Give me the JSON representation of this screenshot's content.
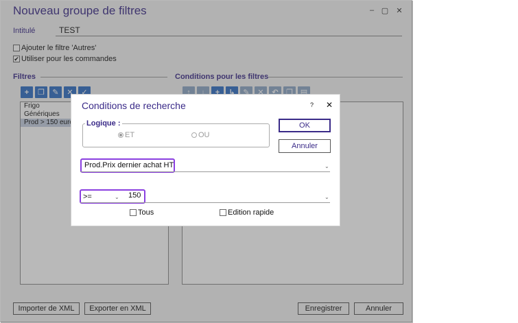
{
  "window": {
    "title": "Nouveau groupe de filtres",
    "controls": [
      "–",
      "▢",
      "✕"
    ]
  },
  "intitule": {
    "label": "Intitulé",
    "value": "TEST"
  },
  "options": [
    {
      "label": "Ajouter le filtre 'Autres'",
      "checked": false
    },
    {
      "label": "Utiliser pour les commandes",
      "checked": true
    }
  ],
  "filtres": {
    "title": "Filtres",
    "toolbar_icons": [
      "add-icon",
      "copy-icon",
      "edit-icon",
      "delete-icon",
      "validate-icon"
    ],
    "items": [
      "Frigo",
      "Génériques",
      "Prod > 150 euro"
    ],
    "selected_index": 2
  },
  "conditions": {
    "title": "Conditions pour les filtres",
    "toolbar_icons": [
      "move-up-icon",
      "move-down-icon",
      "add-icon",
      "indent-icon",
      "edit-icon",
      "delete-icon",
      "undo-icon",
      "copy-icon",
      "paste-icon"
    ]
  },
  "footer": {
    "import": "Importer de XML",
    "export": "Exporter en XML",
    "save": "Enregistrer",
    "cancel": "Annuler"
  },
  "dialog": {
    "title": "Conditions de recherche",
    "help": "?",
    "close": "✕",
    "logic_label": "Logique :",
    "radio_et": "ET",
    "radio_ou": "OU",
    "selected_logic": "ET",
    "ok_label": "OK",
    "cancel_label": "Annuler",
    "field_value": "Prod.Prix dernier achat HT",
    "operator_value": ">=",
    "amount_value": "150",
    "tous_label": "Tous",
    "edition_label": "Edition rapide",
    "highlight_color": "#8a3fe0",
    "accent_color": "#3a2a88"
  }
}
